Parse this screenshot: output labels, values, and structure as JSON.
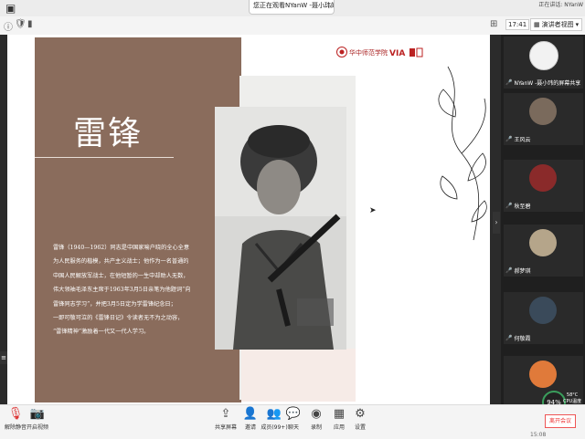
{
  "window": {
    "share_notice": "您正在观看NYanW -聂小玮的屏幕",
    "share_more": "…",
    "topright_text": "正在讲话: NYanW",
    "time": "17:41",
    "speaker_view": "演讲者视图"
  },
  "slide": {
    "title": "雷锋",
    "body_lines": [
      "雷锋（1940—1962）同志是中国家喻户晓的全心全意",
      "为人民服务的楷模，共产主义战士；他作为一名普通的",
      "中国人民解放军战士，在他短暂的一生中却助人无数，",
      "伟大领袖毛泽东主席于1963年3月5日亲笔为他题词“向",
      "雷锋同志学习”，并把3月5日定为学雷锋纪念日；",
      "一即可敬可泣的《雷锋日记》令读者无不为之动容，",
      "“雷锋精神”激励着一代又一代人学习。"
    ],
    "logo_text": "华中师范学院",
    "logo_abbrev": "VIA"
  },
  "participants": [
    {
      "name": "NYanW -聂小玮的屏幕共享",
      "color": "#f0f0f0"
    },
    {
      "name": "王风云",
      "color": "#7a6a5c"
    },
    {
      "name": "秋至碧",
      "color": "#8a2a2a"
    },
    {
      "name": "郝梦琪",
      "color": "#b5a58a"
    },
    {
      "name": "何敬霞",
      "color": "#3a4a5a"
    },
    {
      "name": "",
      "color": "#e07a3a"
    }
  ],
  "bottom_bar": {
    "mute": "解除静音",
    "video": "开启视频",
    "share": "共享屏幕",
    "invite": "邀请",
    "members": "成员(99+)",
    "chat": "聊天",
    "record": "录制",
    "apps": "应用",
    "settings": "设置",
    "leave": "离开会议",
    "cpu_percent": "94%",
    "temp": "58°C",
    "cpu_label": "CPU温度",
    "time": "15:08"
  }
}
